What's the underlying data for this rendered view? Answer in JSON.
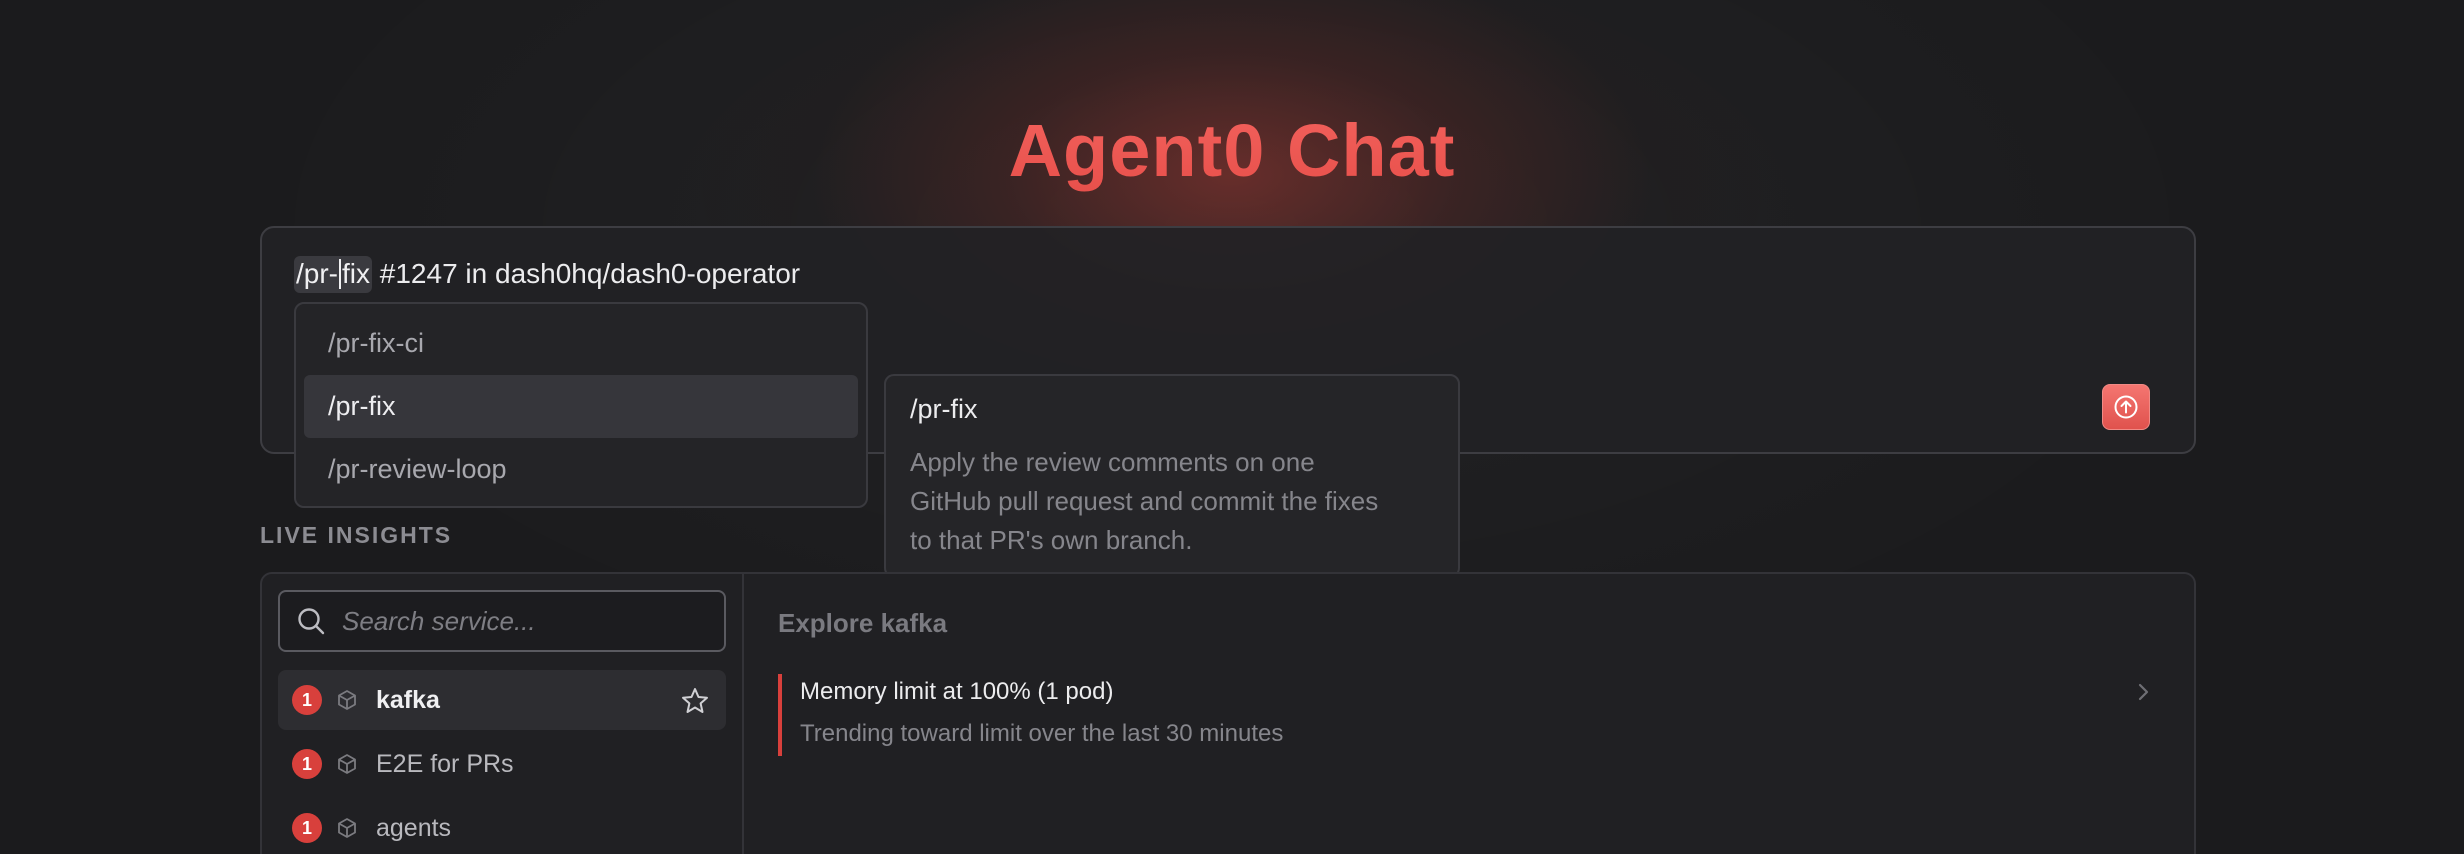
{
  "page": {
    "title": "Agent0 Chat"
  },
  "composer": {
    "command": "/pr-fix",
    "command_before_caret": "/pr-",
    "command_after_caret": "fix",
    "rest_text": " #1247 in dash0hq/dash0-operator",
    "send_icon": "arrow-up-icon"
  },
  "autocomplete": {
    "items": [
      {
        "label": "/pr-fix-ci",
        "active": false
      },
      {
        "label": "/pr-fix",
        "active": true
      },
      {
        "label": "/pr-review-loop",
        "active": false
      }
    ]
  },
  "tooltip": {
    "title": "/pr-fix",
    "description_lines": [
      "Apply the review comments on one",
      "GitHub pull request and commit the fixes",
      "to that PR's own branch."
    ]
  },
  "insights": {
    "section_label": "LIVE INSIGHTS",
    "search": {
      "placeholder": "Search service..."
    },
    "services": [
      {
        "name": "kafka",
        "count": "1",
        "active": true,
        "starred_icon": "star-outline-icon"
      },
      {
        "name": "E2E for PRs",
        "count": "1",
        "active": false
      },
      {
        "name": "agents",
        "count": "1",
        "active": false
      }
    ],
    "explore_title": "Explore kafka",
    "items": [
      {
        "title": "Memory limit at 100% (1 pod)",
        "subtitle": "Trending toward limit over the last 30 minutes"
      }
    ]
  },
  "colors": {
    "accent": "#e8504b",
    "badge": "#d8403c",
    "background": "#1b1b1d"
  }
}
